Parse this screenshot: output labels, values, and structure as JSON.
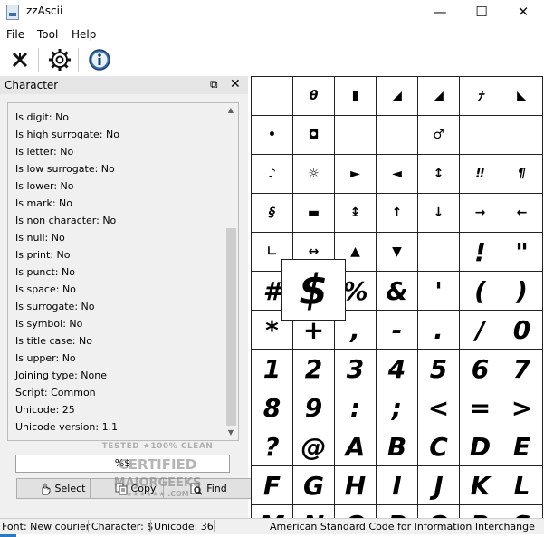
{
  "window": {
    "title": "zzAscii",
    "minimize_glyph": "—",
    "maximize_glyph": "☐",
    "close_glyph": "✕"
  },
  "menu": [
    "File",
    "Tool",
    "Help"
  ],
  "toolbar": {
    "icons": [
      "cut-icon",
      "gear-icon",
      "info-icon"
    ]
  },
  "panel": {
    "title": "Character",
    "float_glyph": "⧉",
    "close_glyph": "✕",
    "properties": [
      "Is digit: No",
      "Is high surrogate: No",
      "Is letter: No",
      "Is low surrogate: No",
      "Is lower: No",
      "Is mark: No",
      "Is non character: No",
      "Is null: No",
      "Is print: No",
      "Is punct: No",
      "Is space: No",
      "Is surrogate: No",
      "Is symbol: No",
      "Is title case: No",
      "Is upper: No",
      "Joining type: None",
      "Script: Common",
      "Unicode: 25",
      "Unicode version: 1.1"
    ],
    "scroll_up": "▲",
    "scroll_down": "▼",
    "field_value": "%$",
    "buttons": {
      "select": "Select",
      "copy": "Copy",
      "find": "Find"
    }
  },
  "grid": {
    "cells": [
      {
        "ch": "",
        "small": false
      },
      {
        "ch": "θ",
        "small": true
      },
      {
        "ch": "▮",
        "small": true
      },
      {
        "ch": "◢",
        "small": true
      },
      {
        "ch": "◢",
        "small": true
      },
      {
        "ch": "ﾅ",
        "small": true
      },
      {
        "ch": "◣",
        "small": true
      },
      {
        "ch": "•",
        "small": true
      },
      {
        "ch": "◘",
        "small": true
      },
      {
        "ch": "",
        "small": false
      },
      {
        "ch": "",
        "small": false
      },
      {
        "ch": "♂",
        "small": true
      },
      {
        "ch": "",
        "small": false
      },
      {
        "ch": "",
        "small": false
      },
      {
        "ch": "♪",
        "small": true
      },
      {
        "ch": "☼",
        "small": true
      },
      {
        "ch": "►",
        "small": true
      },
      {
        "ch": "◄",
        "small": true
      },
      {
        "ch": "↕",
        "small": true
      },
      {
        "ch": "‼",
        "small": true
      },
      {
        "ch": "¶",
        "small": true
      },
      {
        "ch": "§",
        "small": true
      },
      {
        "ch": "▬",
        "small": true
      },
      {
        "ch": "↨",
        "small": true
      },
      {
        "ch": "↑",
        "small": true
      },
      {
        "ch": "↓",
        "small": true
      },
      {
        "ch": "→",
        "small": true
      },
      {
        "ch": "←",
        "small": true
      },
      {
        "ch": "∟",
        "small": true
      },
      {
        "ch": "↔",
        "small": true
      },
      {
        "ch": "▲",
        "small": true
      },
      {
        "ch": "▼",
        "small": true
      },
      {
        "ch": "",
        "small": false
      },
      {
        "ch": "!",
        "small": false
      },
      {
        "ch": "\"",
        "small": false
      },
      {
        "ch": "#",
        "small": false
      },
      {
        "ch": "",
        "small": false
      },
      {
        "ch": "%",
        "small": false
      },
      {
        "ch": "&",
        "small": false
      },
      {
        "ch": "'",
        "small": false
      },
      {
        "ch": "(",
        "small": false
      },
      {
        "ch": ")",
        "small": false
      },
      {
        "ch": "*",
        "small": false
      },
      {
        "ch": "+",
        "small": false
      },
      {
        "ch": ",",
        "small": false
      },
      {
        "ch": "-",
        "small": false
      },
      {
        "ch": ".",
        "small": false
      },
      {
        "ch": "/",
        "small": false
      },
      {
        "ch": "0",
        "small": false
      },
      {
        "ch": "1",
        "small": false
      },
      {
        "ch": "2",
        "small": false
      },
      {
        "ch": "3",
        "small": false
      },
      {
        "ch": "4",
        "small": false
      },
      {
        "ch": "5",
        "small": false
      },
      {
        "ch": "6",
        "small": false
      },
      {
        "ch": "7",
        "small": false
      },
      {
        "ch": "8",
        "small": false
      },
      {
        "ch": "9",
        "small": false
      },
      {
        "ch": ":",
        "small": false
      },
      {
        "ch": ";",
        "small": false
      },
      {
        "ch": "<",
        "small": false
      },
      {
        "ch": "=",
        "small": false
      },
      {
        "ch": ">",
        "small": false
      },
      {
        "ch": "?",
        "small": false
      },
      {
        "ch": "@",
        "small": false
      },
      {
        "ch": "A",
        "small": false
      },
      {
        "ch": "B",
        "small": false
      },
      {
        "ch": "C",
        "small": false
      },
      {
        "ch": "D",
        "small": false
      },
      {
        "ch": "E",
        "small": false
      },
      {
        "ch": "F",
        "small": false
      },
      {
        "ch": "G",
        "small": false
      },
      {
        "ch": "H",
        "small": false
      },
      {
        "ch": "I",
        "small": false
      },
      {
        "ch": "J",
        "small": false
      },
      {
        "ch": "K",
        "small": false
      },
      {
        "ch": "L",
        "small": false
      },
      {
        "ch": "M",
        "small": false
      },
      {
        "ch": "N",
        "small": false
      },
      {
        "ch": "O",
        "small": false
      },
      {
        "ch": "P",
        "small": false
      },
      {
        "ch": "Q",
        "small": false
      },
      {
        "ch": "R",
        "small": false
      },
      {
        "ch": "S",
        "small": false
      }
    ],
    "zoom_char": "$"
  },
  "status": {
    "font": "Font: New courier",
    "character": "Character: $",
    "unicode": "Unicode: 36",
    "description": "American Standard Code for Information Interchange"
  },
  "watermark": {
    "line1": "TESTED ★100% CLEAN",
    "line2": "CERTIFIED",
    "line3": "MAJORGEEKS",
    "line4": "★★★★★★ .COM"
  }
}
